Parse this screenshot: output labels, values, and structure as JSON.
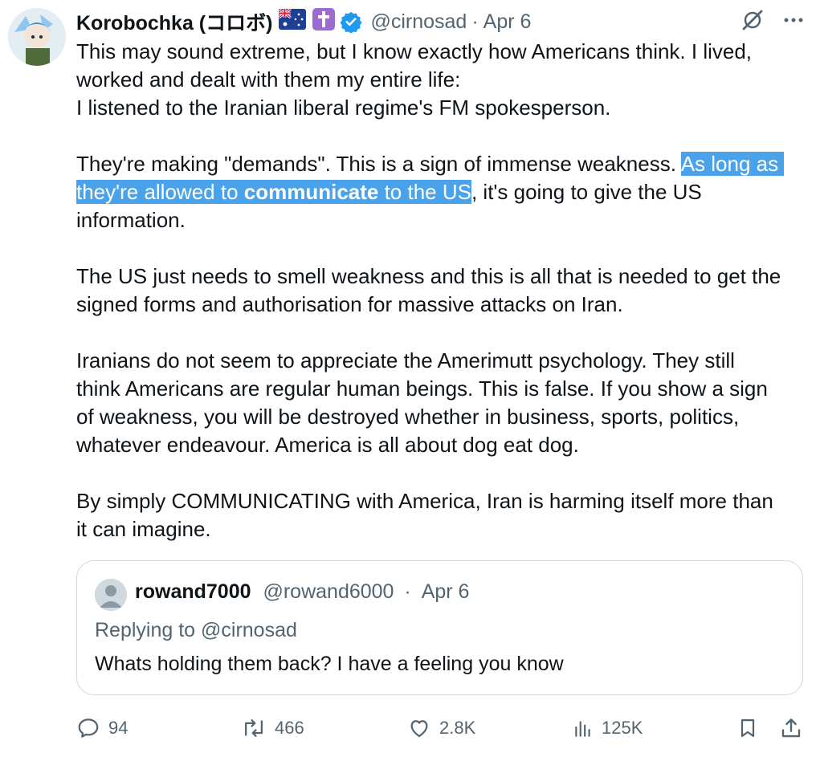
{
  "tweet": {
    "display_name": "Korobochka (コロボ)",
    "flag_icon": "australia-flag-icon",
    "cross_icon": "latin-cross-icon",
    "handle": "@cirnosad",
    "separator": "·",
    "date": "Apr 6",
    "body": {
      "p1_l1": "This may sound extreme, but I know exactly how Americans think. I lived,",
      "p1_l2": "worked and dealt with them my entire life:",
      "p1_l3": "I listened to the Iranian liberal regime's FM spokesperson.",
      "p2_before": "They're making \"demands\". This is a sign of immense weakness. ",
      "p2_hl_start": "As long as",
      "p2_hl_mid1": "they're allowed to ",
      "p2_hl_bold": "communicate",
      "p2_hl_mid2": " to the US",
      "p2_after": ", it's going to give the US",
      "p2_l3": "information.",
      "p3_l1": "The US just needs to smell weakness and this is all that is needed to get the",
      "p3_l2": "signed forms and authorisation for massive attacks on Iran.",
      "p4_l1": "Iranians do not seem to appreciate the Amerimutt psychology. They still",
      "p4_l2": "think Americans are regular human beings. This is false. If you show a sign",
      "p4_l3": "of weakness, you will be destroyed whether in business, sports, politics,",
      "p4_l4": "whatever endeavour. America is all about dog eat dog.",
      "p5_l1": "By simply COMMUNICATING with America, Iran is harming itself more than",
      "p5_l2": "it can imagine."
    }
  },
  "quoted": {
    "display_name": "rowand7000",
    "handle": "@rowand6000",
    "separator": "·",
    "date": "Apr 6",
    "replying_to": "Replying to @cirnosad",
    "text": "Whats holding them back? I have a feeling you know"
  },
  "actions": {
    "replies": "94",
    "reposts": "466",
    "likes": "2.8K",
    "views": "125K"
  },
  "colors": {
    "text": "#0f1419",
    "secondary": "#536471",
    "highlight": "#4aa3ea",
    "verified": "#1d9bf0",
    "cross_badge": "#9b6bd1"
  }
}
